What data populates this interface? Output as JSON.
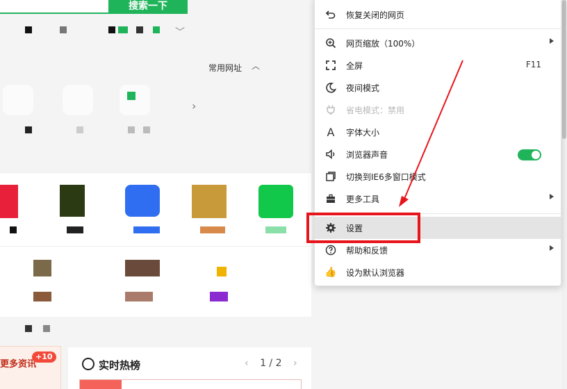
{
  "background": {
    "search_button": "搜索一下",
    "common_sites_label": "常用网址",
    "news_label": "更多资讯",
    "news_badge": "+10",
    "hot_title": "实时热榜",
    "pager": {
      "prev": "‹",
      "current": "1 / 2",
      "next": "›"
    }
  },
  "menu": {
    "items": [
      {
        "id": "restore-closed",
        "icon": "undo-icon",
        "label": "恢复关闭的网页",
        "shortcut": "",
        "submenu": false,
        "disabled": false
      },
      {
        "id": "zoom",
        "icon": "zoom-icon",
        "label": "网页缩放（100%）",
        "shortcut": "",
        "submenu": true,
        "disabled": false
      },
      {
        "id": "fullscreen",
        "icon": "fullscreen-icon",
        "label": "全屏",
        "shortcut": "F11",
        "submenu": false,
        "disabled": false
      },
      {
        "id": "night-mode",
        "icon": "moon-icon",
        "label": "夜间模式",
        "shortcut": "",
        "submenu": false,
        "disabled": false
      },
      {
        "id": "power-save",
        "icon": "plug-icon",
        "label": "省电模式：禁用",
        "shortcut": "",
        "submenu": false,
        "disabled": true
      },
      {
        "id": "font-size",
        "icon": "font-icon",
        "label": "字体大小",
        "shortcut": "",
        "submenu": false,
        "disabled": false
      },
      {
        "id": "sound",
        "icon": "speaker-icon",
        "label": "浏览器声音",
        "shortcut": "",
        "submenu": false,
        "disabled": false,
        "toggle": true
      },
      {
        "id": "ie6-mode",
        "icon": "window-icon",
        "label": "切换到IE6多窗口模式",
        "shortcut": "",
        "submenu": false,
        "disabled": false
      },
      {
        "id": "more-tools",
        "icon": "toolbox-icon",
        "label": "更多工具",
        "shortcut": "",
        "submenu": true,
        "disabled": false
      },
      {
        "id": "settings",
        "icon": "gear-icon",
        "label": "设置",
        "shortcut": "",
        "submenu": false,
        "disabled": false,
        "highlighted": true
      },
      {
        "id": "help",
        "icon": "help-icon",
        "label": "帮助和反馈",
        "shortcut": "",
        "submenu": true,
        "disabled": false
      },
      {
        "id": "default-browser",
        "icon": "thumbs-up-icon",
        "label": "设为默认浏览器",
        "shortcut": "",
        "submenu": false,
        "disabled": false
      }
    ]
  },
  "colors": {
    "accent": "#1fb45a",
    "annotation": "#e8141c"
  }
}
